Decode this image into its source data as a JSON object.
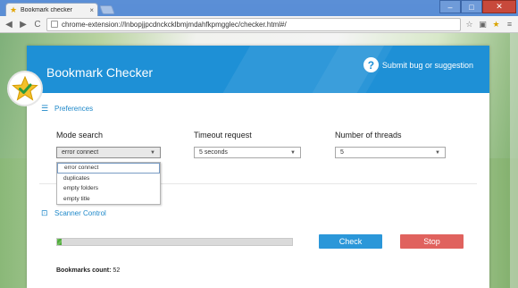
{
  "browser": {
    "tab_title": "Bookmark checker",
    "tab_close": "×",
    "url": "chrome-extension://lnbopjjpcdnckcklbmjmdahfkpmgglec/checker.html#/",
    "win_minimize": "–",
    "win_maximize": "□",
    "win_close": "✕",
    "back": "◀",
    "forward": "▶",
    "reload": "C"
  },
  "header": {
    "title": "Bookmark Checker",
    "report_label": "Submit bug or suggestion",
    "report_icon_glyph": "?"
  },
  "preferences": {
    "title": "Preferences",
    "mode": {
      "label": "Mode search",
      "value": "error connect"
    },
    "timeout": {
      "label": "Timeout request",
      "value": "5 seconds"
    },
    "threads": {
      "label": "Number of threads",
      "value": "5"
    },
    "mode_options": [
      "error connect",
      "duplicates",
      "empty folders",
      "empty title"
    ]
  },
  "scanner": {
    "title": "Scanner Control",
    "progress": 0.02,
    "check_label": "Check",
    "stop_label": "Stop",
    "count_label": "Bookmarks count:",
    "count_value": "52"
  },
  "colors": {
    "header": "#1e90d6",
    "check": "#2b97d9",
    "stop": "#e0625e",
    "progress": "#4fa83c"
  }
}
